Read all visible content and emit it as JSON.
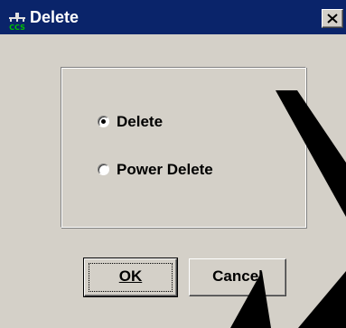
{
  "window": {
    "title": "Delete",
    "icon": "ccs-app-icon",
    "close_label": "×"
  },
  "options": [
    {
      "label": "Delete",
      "checked": true
    },
    {
      "label": "Power Delete",
      "checked": false
    }
  ],
  "buttons": {
    "ok_label": "OK",
    "cancel_label": "Cancel"
  },
  "colors": {
    "title_bar": "#0a246a",
    "dialog_face": "#d4d0c8",
    "watermark": "#000000"
  }
}
